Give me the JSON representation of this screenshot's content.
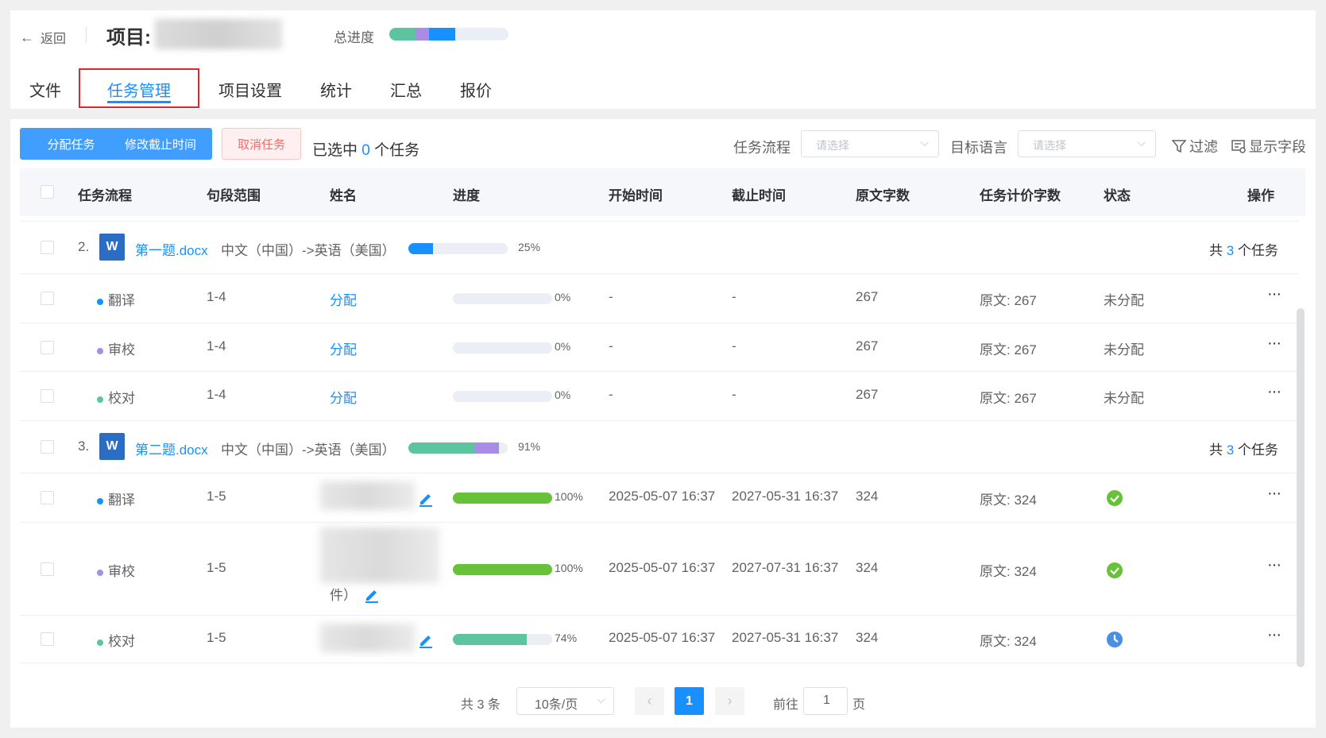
{
  "header": {
    "back_label": "返回",
    "project_label": "项目:",
    "total_progress_label": "总进度",
    "total_progress": {
      "green": 0.22,
      "purple": 0.11,
      "blue": 0.22
    }
  },
  "tabs": [
    "文件",
    "任务管理",
    "项目设置",
    "统计",
    "汇总",
    "报价"
  ],
  "active_tab": "任务管理",
  "toolbar": {
    "assign_label": "分配任务",
    "deadline_label": "修改截止时间",
    "cancel_label": "取消任务",
    "selected_prefix": "已选中 ",
    "selected_count": "0",
    "selected_suffix": " 个任务",
    "workflow_label": "任务流程",
    "workflow_placeholder": "请选择",
    "target_lang_label": "目标语言",
    "target_lang_placeholder": "请选择",
    "filter_label": "过滤",
    "fields_label": "显示字段"
  },
  "columns": [
    "任务流程",
    "句段范围",
    "姓名",
    "进度",
    "开始时间",
    "截止时间",
    "原文字数",
    "任务计价字数",
    "状态",
    "操作"
  ],
  "files": [
    {
      "index": "2.",
      "icon": "W",
      "name": "第一题.docx",
      "lang": "中文（中国）->英语（美国）",
      "progress": 0.25,
      "progress_text": "25%",
      "count_prefix": "共 ",
      "count": "3",
      "count_suffix": " 个任务",
      "tasks": [
        {
          "workflow": "翻译",
          "range": "1-4",
          "assignee": "分配",
          "progress": 0,
          "progress_text": "0%",
          "start": "-",
          "end": "-",
          "words": "267",
          "billing": "原文: 267",
          "status": "未分配",
          "more": "···"
        },
        {
          "workflow": "审校",
          "range": "1-4",
          "assignee": "分配",
          "progress": 0,
          "progress_text": "0%",
          "start": "-",
          "end": "-",
          "words": "267",
          "billing": "原文: 267",
          "status": "未分配",
          "more": "···"
        },
        {
          "workflow": "校对",
          "range": "1-4",
          "assignee": "分配",
          "progress": 0,
          "progress_text": "0%",
          "start": "-",
          "end": "-",
          "words": "267",
          "billing": "原文: 267",
          "status": "未分配",
          "more": "···"
        }
      ]
    },
    {
      "index": "3.",
      "icon": "W",
      "name": "第二题.docx",
      "lang": "中文（中国）->英语（美国）",
      "progress": 0.91,
      "progress_text": "91%",
      "count_prefix": "共 ",
      "count": "3",
      "count_suffix": " 个任务",
      "tasks": [
        {
          "workflow": "翻译",
          "range": "1-5",
          "progress": 1.0,
          "progress_text": "100%",
          "start": "2025-05-07 16:37",
          "end": "2027-05-31 16:37",
          "words": "324",
          "billing": "原文: 324",
          "status_icon": "check-circle-icon",
          "more": "···"
        },
        {
          "workflow": "审校",
          "range": "1-5",
          "assignee_suffix": "件）",
          "progress": 1.0,
          "progress_text": "100%",
          "start": "2025-05-07 16:37",
          "end": "2027-07-31 16:37",
          "words": "324",
          "billing": "原文: 324",
          "status_icon": "check-circle-icon",
          "more": "···"
        },
        {
          "workflow": "校对",
          "range": "1-5",
          "progress": 0.74,
          "progress_text": "74%",
          "start": "2025-05-07 16:37",
          "end": "2027-05-31 16:37",
          "words": "324",
          "billing": "原文: 324",
          "status_icon": "clock-icon",
          "more": "···"
        }
      ]
    }
  ],
  "colors": {
    "primary": "#1890ff",
    "translate": "#1890ff",
    "review": "#a98ce8",
    "proof": "#5cc5a0",
    "done": "#67c23a",
    "danger": "#e8232a"
  },
  "pagination": {
    "total": "共 3 条",
    "page_size": "10条/页",
    "current_page": "1",
    "goto_prefix": "前往",
    "goto_value": "1",
    "goto_suffix": "页"
  }
}
